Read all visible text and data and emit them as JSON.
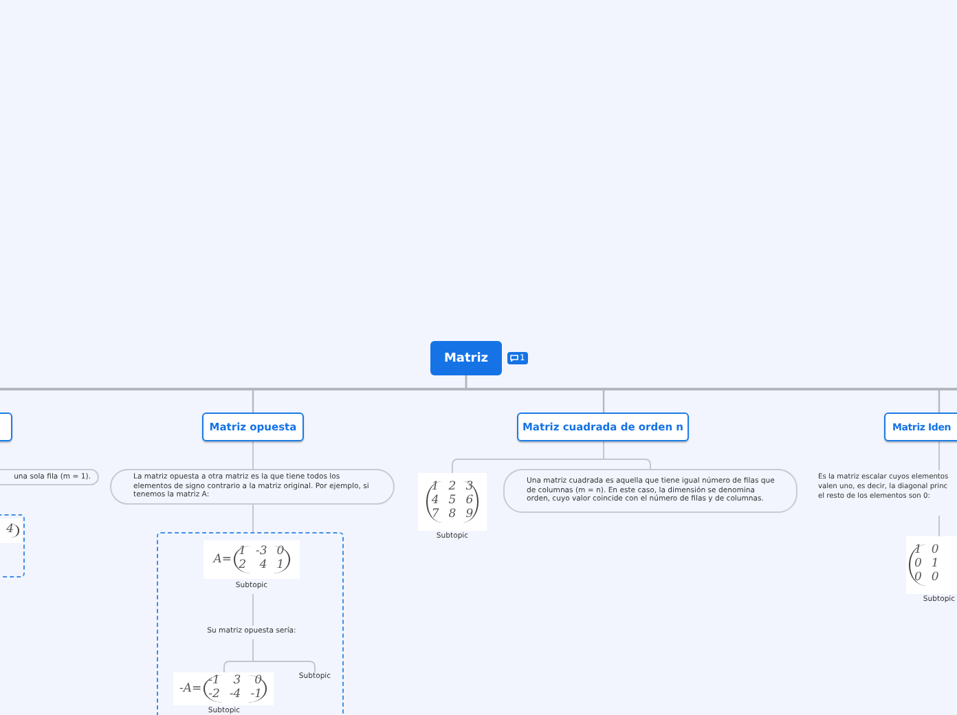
{
  "root": {
    "label": "Matriz",
    "comment_count": "1"
  },
  "nodes": [
    {
      "kind": "topic"
    },
    {
      "kind": "bubble",
      "text": "una sola fila (m = 1)."
    },
    {
      "kind": "boundary"
    },
    {
      "kind": "matrix",
      "rows": [
        [
          "4"
        ]
      ],
      "bracket_left": false,
      "bracket_right": true
    },
    {
      "kind": "topic",
      "label": "Matriz opuesta"
    },
    {
      "kind": "bubble",
      "text": "La matriz opuesta a otra matriz es la que tiene todos los elementos de signo contrario a la matriz original. Por ejemplo, si tenemos la matriz A:"
    },
    {
      "kind": "boundary"
    },
    {
      "kind": "matrix",
      "prefix": "A=",
      "rows": [
        [
          "1",
          "-3",
          "0"
        ],
        [
          "2",
          "4",
          "1"
        ]
      ],
      "bracket_left": true,
      "bracket_right": true
    },
    {
      "kind": "caption",
      "text": "Subtopic"
    },
    {
      "kind": "caption",
      "text": "Su matriz opuesta sería:"
    },
    {
      "kind": "matrix",
      "prefix": "-A=",
      "rows": [
        [
          "-1",
          "3",
          "0"
        ],
        [
          "-2",
          "-4",
          "-1"
        ]
      ],
      "bracket_left": true,
      "bracket_right": true
    },
    {
      "kind": "caption",
      "text": "Subtopic"
    },
    {
      "kind": "caption",
      "text": "Subtopic"
    },
    {
      "kind": "topic",
      "label": "Matriz cuadrada de orden n"
    },
    {
      "kind": "matrix",
      "rows": [
        [
          "1",
          "2",
          "3"
        ],
        [
          "4",
          "5",
          "6"
        ],
        [
          "7",
          "8",
          "9"
        ]
      ],
      "bracket_left": true,
      "bracket_right": true
    },
    {
      "kind": "caption",
      "text": "Subtopic"
    },
    {
      "kind": "bubble",
      "text": "Una matriz cuadrada es aquella que tiene igual número de filas que de columnas (m = n). En este caso, la dimensión se denomina orden, cuyo valor coincide con el número de filas y de columnas."
    },
    {
      "kind": "topic",
      "label": "Matriz Iden"
    },
    {
      "kind": "plain",
      "lines": [
        "Es la matriz escalar cuyos elementos",
        "valen uno, es decir, la diagonal princ",
        "el resto de los elementos son 0:"
      ]
    },
    {
      "kind": "matrix",
      "rows": [
        [
          "1",
          "0"
        ],
        [
          "0",
          "1"
        ],
        [
          "0",
          "0"
        ]
      ],
      "bracket_left": true,
      "bracket_right": false
    },
    {
      "kind": "caption",
      "text": "Subtopic"
    }
  ]
}
